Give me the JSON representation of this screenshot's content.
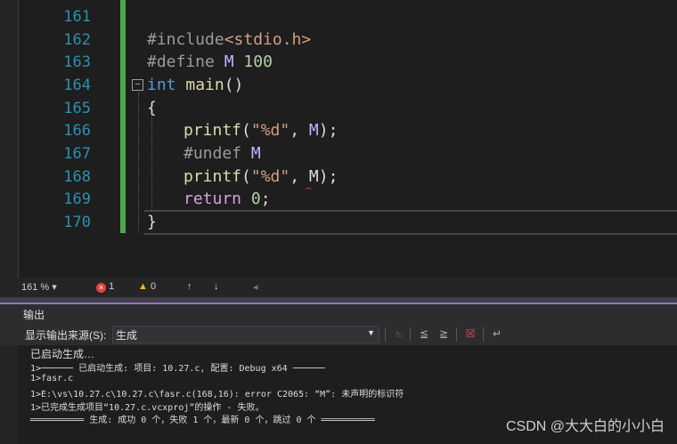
{
  "editor": {
    "line_numbers": [
      "161",
      "162",
      "163",
      "164",
      "165",
      "166",
      "167",
      "168",
      "169",
      "170"
    ],
    "lines": {
      "l162_a": "#include",
      "l162_b": "<stdio.h>",
      "l163_a": "#define",
      "l163_b": "M",
      "l163_c": "100",
      "l164_a": "int",
      "l164_b": "main",
      "l164_c": "()",
      "l165": "{",
      "l166_a": "printf",
      "l166_b": "(",
      "l166_c": "\"%d\"",
      "l166_d": ", ",
      "l166_e": "M",
      "l166_f": ");",
      "l167_a": "#undef",
      "l167_b": "M",
      "l168_a": "printf",
      "l168_b": "(",
      "l168_c": "\"%d\"",
      "l168_d": ", ",
      "l168_e": "M",
      "l168_f": ");",
      "l169_a": "return",
      "l169_b": "0",
      "l169_c": ";",
      "l170": "}"
    }
  },
  "status": {
    "zoom": "161 %",
    "zoom_chevron": "▾",
    "errors": "1",
    "warnings": "0",
    "up_arrow": "↑",
    "down_arrow": "↓",
    "left_arrow": "◂"
  },
  "output": {
    "title": "输出",
    "source_label": "显示输出来源(S):",
    "source_value": "生成",
    "lines": [
      "已启动生成…",
      "1>────── 已启动生成: 项目: 10.27.c, 配置: Debug x64 ──────",
      "1>fasr.c",
      "1>E:\\vs\\10.27.c\\10.27.c\\fasr.c(168,16): error C2065: “M”: 未声明的标识符",
      "1>已完成生成项目“10.27.c.vcxproj”的操作 - 失败。",
      "══════════ 生成: 成功 0 个，失败 1 个，最新 0 个，跳过 0 个 ══════════"
    ]
  },
  "watermark": "CSDN @大大白的小小白",
  "colors": {
    "line_number": "#2b91af",
    "keyword": "#569cd6",
    "function": "#dcdcaa",
    "string": "#d69d85",
    "macro": "#beb7ff",
    "change_bar": "#4ea84e"
  }
}
